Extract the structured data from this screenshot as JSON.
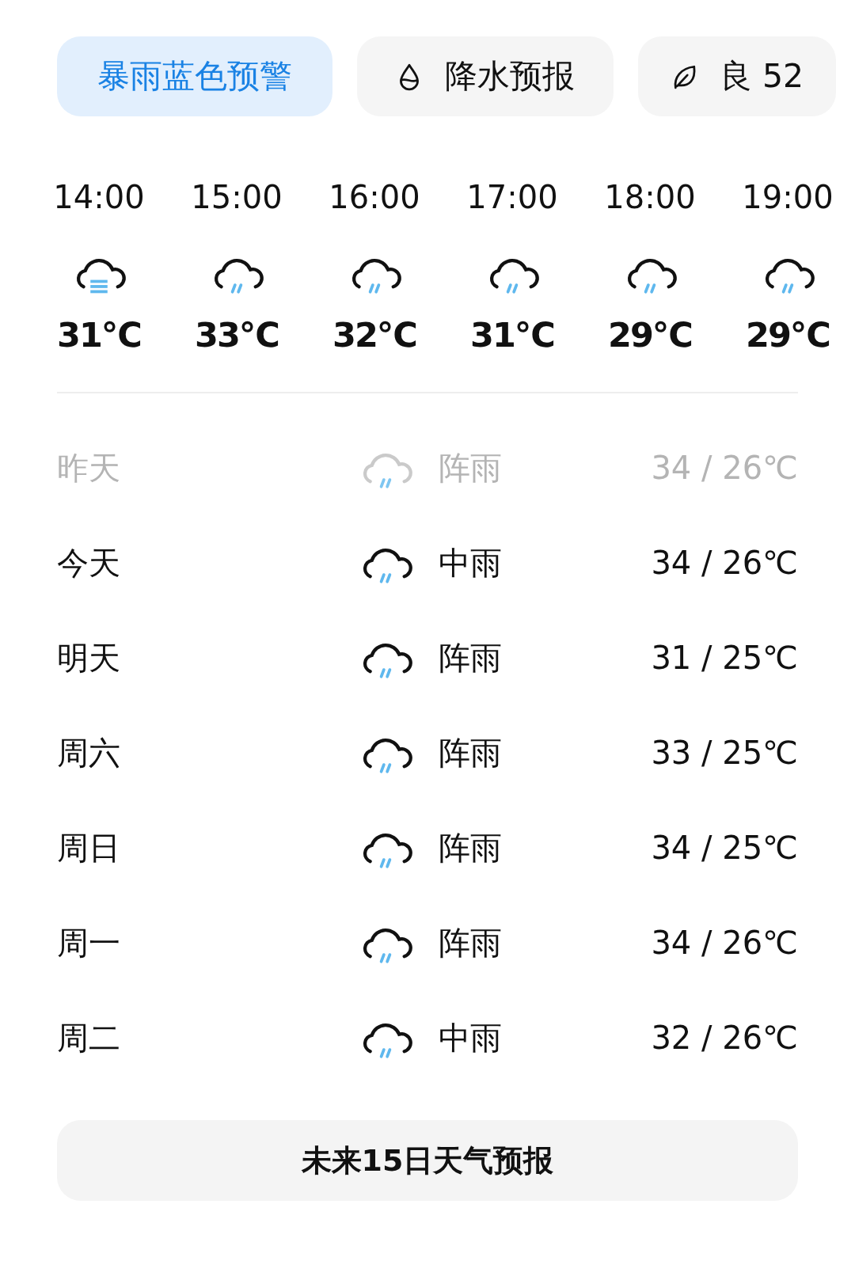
{
  "chips": [
    {
      "kind": "alert",
      "label": "暴雨蓝色预警"
    },
    {
      "kind": "precip",
      "label": "降水预报"
    },
    {
      "kind": "aqi",
      "label": "良 52"
    }
  ],
  "hourly": [
    {
      "time": "14:00",
      "kind": "bars",
      "temp": "31℃"
    },
    {
      "time": "15:00",
      "kind": "rain",
      "temp": "33℃"
    },
    {
      "time": "16:00",
      "kind": "rain",
      "temp": "32℃"
    },
    {
      "time": "17:00",
      "kind": "rain",
      "temp": "31℃"
    },
    {
      "time": "18:00",
      "kind": "rain",
      "temp": "29℃"
    },
    {
      "time": "19:00",
      "kind": "rain",
      "temp": "29℃"
    }
  ],
  "daily": [
    {
      "day": "昨天",
      "past": true,
      "condition": "阵雨",
      "temps": "34 / 26℃"
    },
    {
      "day": "今天",
      "past": false,
      "condition": "中雨",
      "temps": "34 / 26℃"
    },
    {
      "day": "明天",
      "past": false,
      "condition": "阵雨",
      "temps": "31 / 25℃"
    },
    {
      "day": "周六",
      "past": false,
      "condition": "阵雨",
      "temps": "33 / 25℃"
    },
    {
      "day": "周日",
      "past": false,
      "condition": "阵雨",
      "temps": "34 / 25℃"
    },
    {
      "day": "周一",
      "past": false,
      "condition": "阵雨",
      "temps": "34 / 26℃"
    },
    {
      "day": "周二",
      "past": false,
      "condition": "中雨",
      "temps": "32 / 26℃"
    }
  ],
  "forecast_button": "未来15日天气预报"
}
